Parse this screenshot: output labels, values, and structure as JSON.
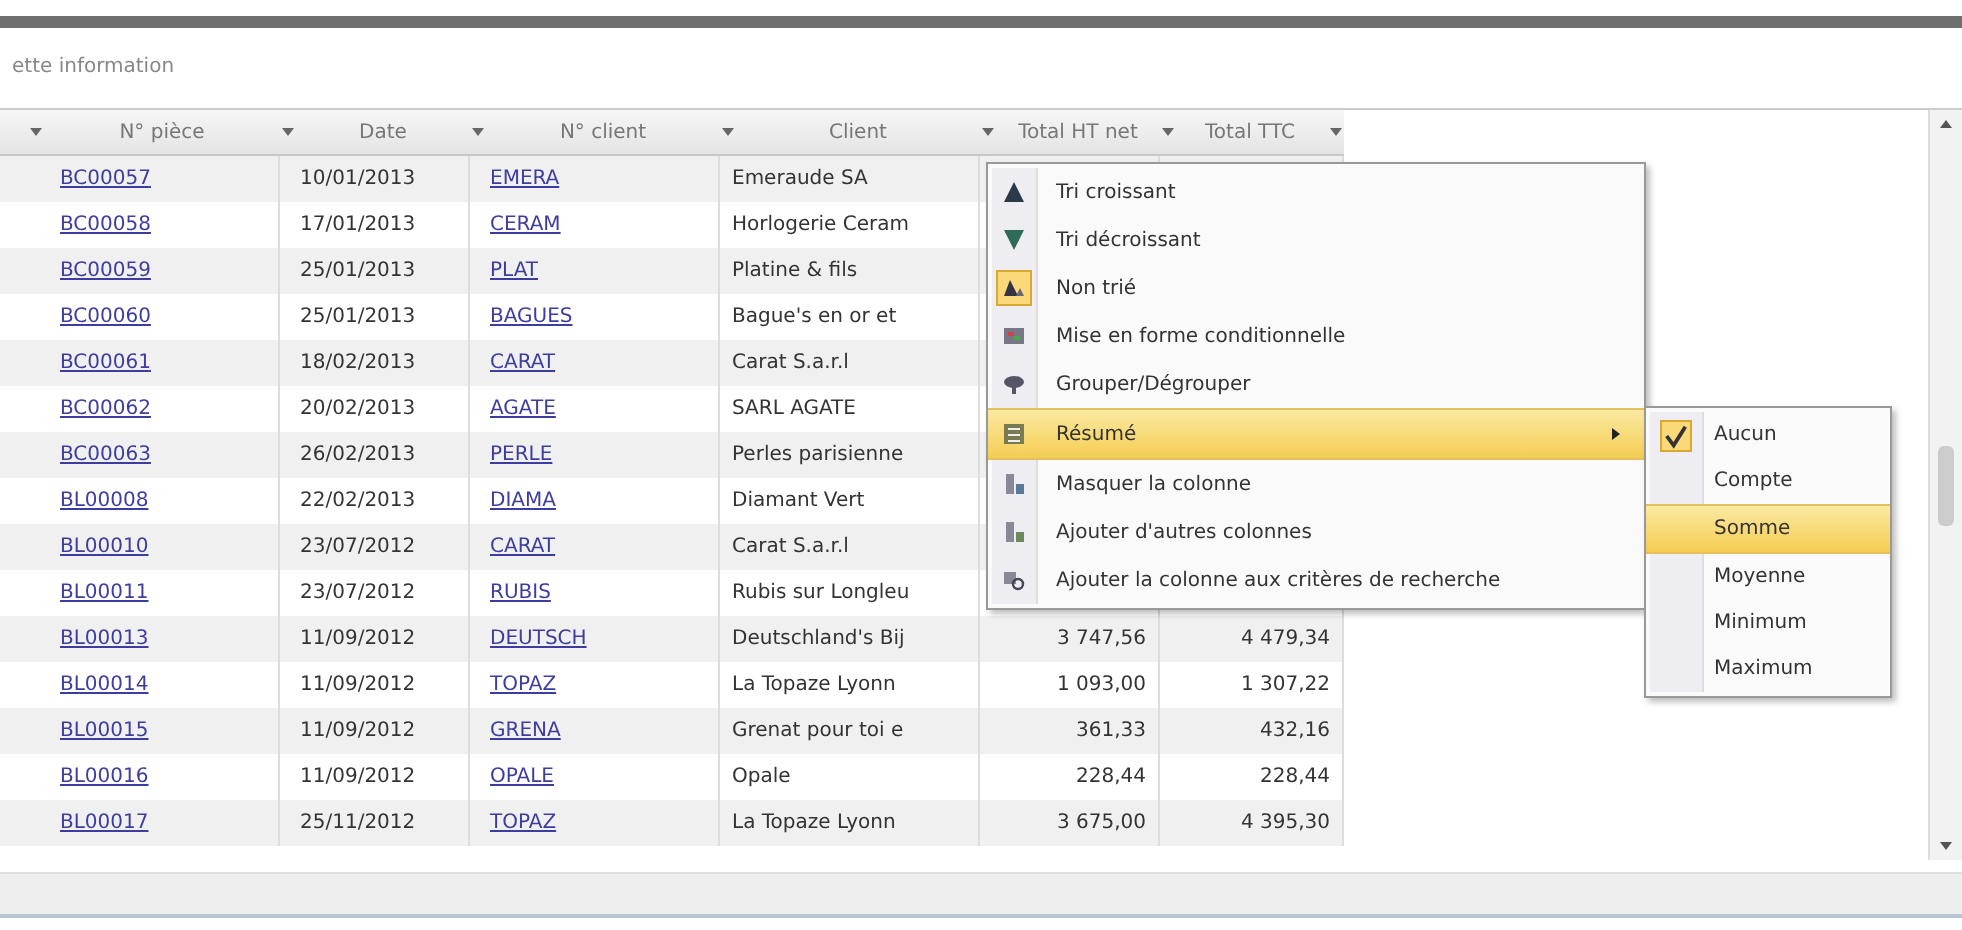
{
  "caption": "ette information",
  "table": {
    "columns": [
      "N° pièce",
      "Date",
      "N° client",
      "Client",
      "Total HT net",
      "Total TTC"
    ],
    "rows": [
      {
        "piece": "BC00057",
        "date": "10/01/2013",
        "client_no": "EMERA",
        "client": "Emeraude SA"
      },
      {
        "piece": "BC00058",
        "date": "17/01/2013",
        "client_no": "CERAM",
        "client": "Horlogerie Ceram"
      },
      {
        "piece": "BC00059",
        "date": "25/01/2013",
        "client_no": "PLAT",
        "client": "Platine & fils"
      },
      {
        "piece": "BC00060",
        "date": "25/01/2013",
        "client_no": "BAGUES",
        "client": "Bague's en or et"
      },
      {
        "piece": "BC00061",
        "date": "18/02/2013",
        "client_no": "CARAT",
        "client": "Carat S.a.r.l"
      },
      {
        "piece": "BC00062",
        "date": "20/02/2013",
        "client_no": "AGATE",
        "client": "SARL AGATE"
      },
      {
        "piece": "BC00063",
        "date": "26/02/2013",
        "client_no": "PERLE",
        "client": "Perles parisienne"
      },
      {
        "piece": "BL00008",
        "date": "22/02/2013",
        "client_no": "DIAMA",
        "client": "Diamant Vert"
      },
      {
        "piece": "BL00010",
        "date": "23/07/2012",
        "client_no": "CARAT",
        "client": "Carat S.a.r.l"
      },
      {
        "piece": "BL00011",
        "date": "23/07/2012",
        "client_no": "RUBIS",
        "client": "Rubis sur Longleu"
      },
      {
        "piece": "BL00013",
        "date": "11/09/2012",
        "client_no": "DEUTSCH",
        "client": "Deutschland's Bij",
        "total_ht": "3 747,56",
        "total_ttc": "4 479,34"
      },
      {
        "piece": "BL00014",
        "date": "11/09/2012",
        "client_no": "TOPAZ",
        "client": "La Topaze Lyonn",
        "total_ht": "1 093,00",
        "total_ttc": "1 307,22"
      },
      {
        "piece": "BL00015",
        "date": "11/09/2012",
        "client_no": "GRENA",
        "client": "Grenat pour toi e",
        "total_ht": "361,33",
        "total_ttc": "432,16"
      },
      {
        "piece": "BL00016",
        "date": "11/09/2012",
        "client_no": "OPALE",
        "client": "Opale",
        "total_ht": "228,44",
        "total_ttc": "228,44"
      },
      {
        "piece": "BL00017",
        "date": "25/11/2012",
        "client_no": "TOPAZ",
        "client": "La Topaze Lyonn",
        "total_ht": "3 675,00",
        "total_ttc": "4 395,30"
      }
    ]
  },
  "context_menu": {
    "items": [
      {
        "kind": "sort-asc",
        "label": "Tri croissant",
        "checked": false,
        "selected": false,
        "submenu": false
      },
      {
        "kind": "sort-desc",
        "label": "Tri décroissant",
        "checked": false,
        "selected": false,
        "submenu": false
      },
      {
        "kind": "unsorted",
        "label": "Non trié",
        "checked": true,
        "selected": false,
        "submenu": false
      },
      {
        "kind": "format",
        "label": "Mise en forme conditionnelle",
        "checked": false,
        "selected": false,
        "submenu": false
      },
      {
        "kind": "group",
        "label": "Grouper/Dégrouper",
        "checked": false,
        "selected": false,
        "submenu": false
      },
      {
        "kind": "summary",
        "label": "Résumé",
        "checked": false,
        "selected": true,
        "submenu": true
      },
      {
        "kind": "hide",
        "label": "Masquer la colonne",
        "checked": false,
        "selected": false,
        "submenu": false
      },
      {
        "kind": "add",
        "label": "Ajouter d'autres colonnes",
        "checked": false,
        "selected": false,
        "submenu": false
      },
      {
        "kind": "search",
        "label": "Ajouter la colonne aux critères de recherche",
        "checked": false,
        "selected": false,
        "submenu": false
      }
    ]
  },
  "submenu": {
    "items": [
      {
        "label": "Aucun",
        "checked": true,
        "selected": false
      },
      {
        "label": "Compte",
        "checked": false,
        "selected": false
      },
      {
        "label": "Somme",
        "checked": false,
        "selected": true
      },
      {
        "label": "Moyenne",
        "checked": false,
        "selected": false
      },
      {
        "label": "Minimum",
        "checked": false,
        "selected": false
      },
      {
        "label": "Maximum",
        "checked": false,
        "selected": false
      }
    ]
  }
}
